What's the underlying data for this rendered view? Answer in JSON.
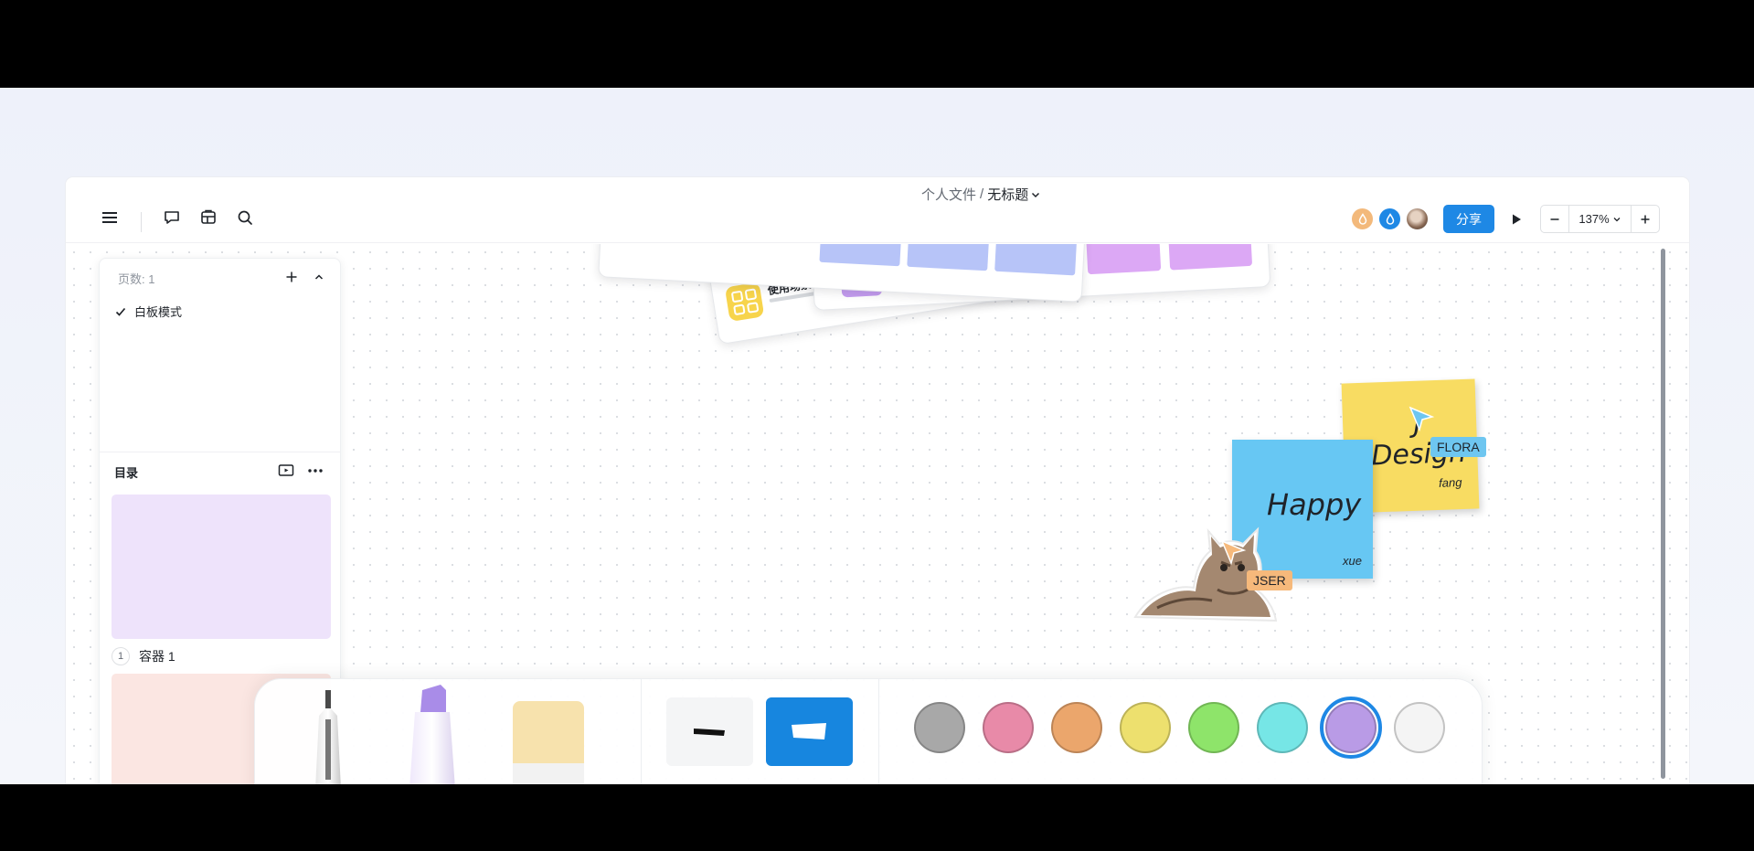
{
  "header": {
    "breadcrumb_parent": "个人文件",
    "breadcrumb_sep": "/",
    "doc_title": "无标题",
    "share_label": "分享",
    "zoom_value": "137%"
  },
  "sidebar": {
    "pages_label": "页数: 1",
    "page_item": "白板模式",
    "toc_title": "目录",
    "containers": [
      {
        "index": "1",
        "name": "容器 1"
      }
    ]
  },
  "canvas": {
    "cards": {
      "card_title": "使用场景"
    },
    "stickies": {
      "yellow_text": "J\nDesign",
      "yellow_author": "fang",
      "blue_text": "Happy",
      "blue_author": "xue"
    },
    "cursors": [
      {
        "name": "FLORA",
        "color": "#6ec6f0"
      },
      {
        "name": "JSER",
        "color": "#f6b97b"
      }
    ]
  },
  "toolbar": {
    "colors": [
      {
        "name": "gray",
        "hex": "#a8a8a8"
      },
      {
        "name": "pink",
        "hex": "#e88aa8"
      },
      {
        "name": "orange",
        "hex": "#eba66c"
      },
      {
        "name": "yellow",
        "hex": "#ede06e"
      },
      {
        "name": "green",
        "hex": "#8ee46a"
      },
      {
        "name": "cyan",
        "hex": "#76e6e6"
      },
      {
        "name": "purple",
        "hex": "#b99be6"
      },
      {
        "name": "white",
        "hex": "#f4f4f4"
      }
    ],
    "selected_color": "purple"
  }
}
